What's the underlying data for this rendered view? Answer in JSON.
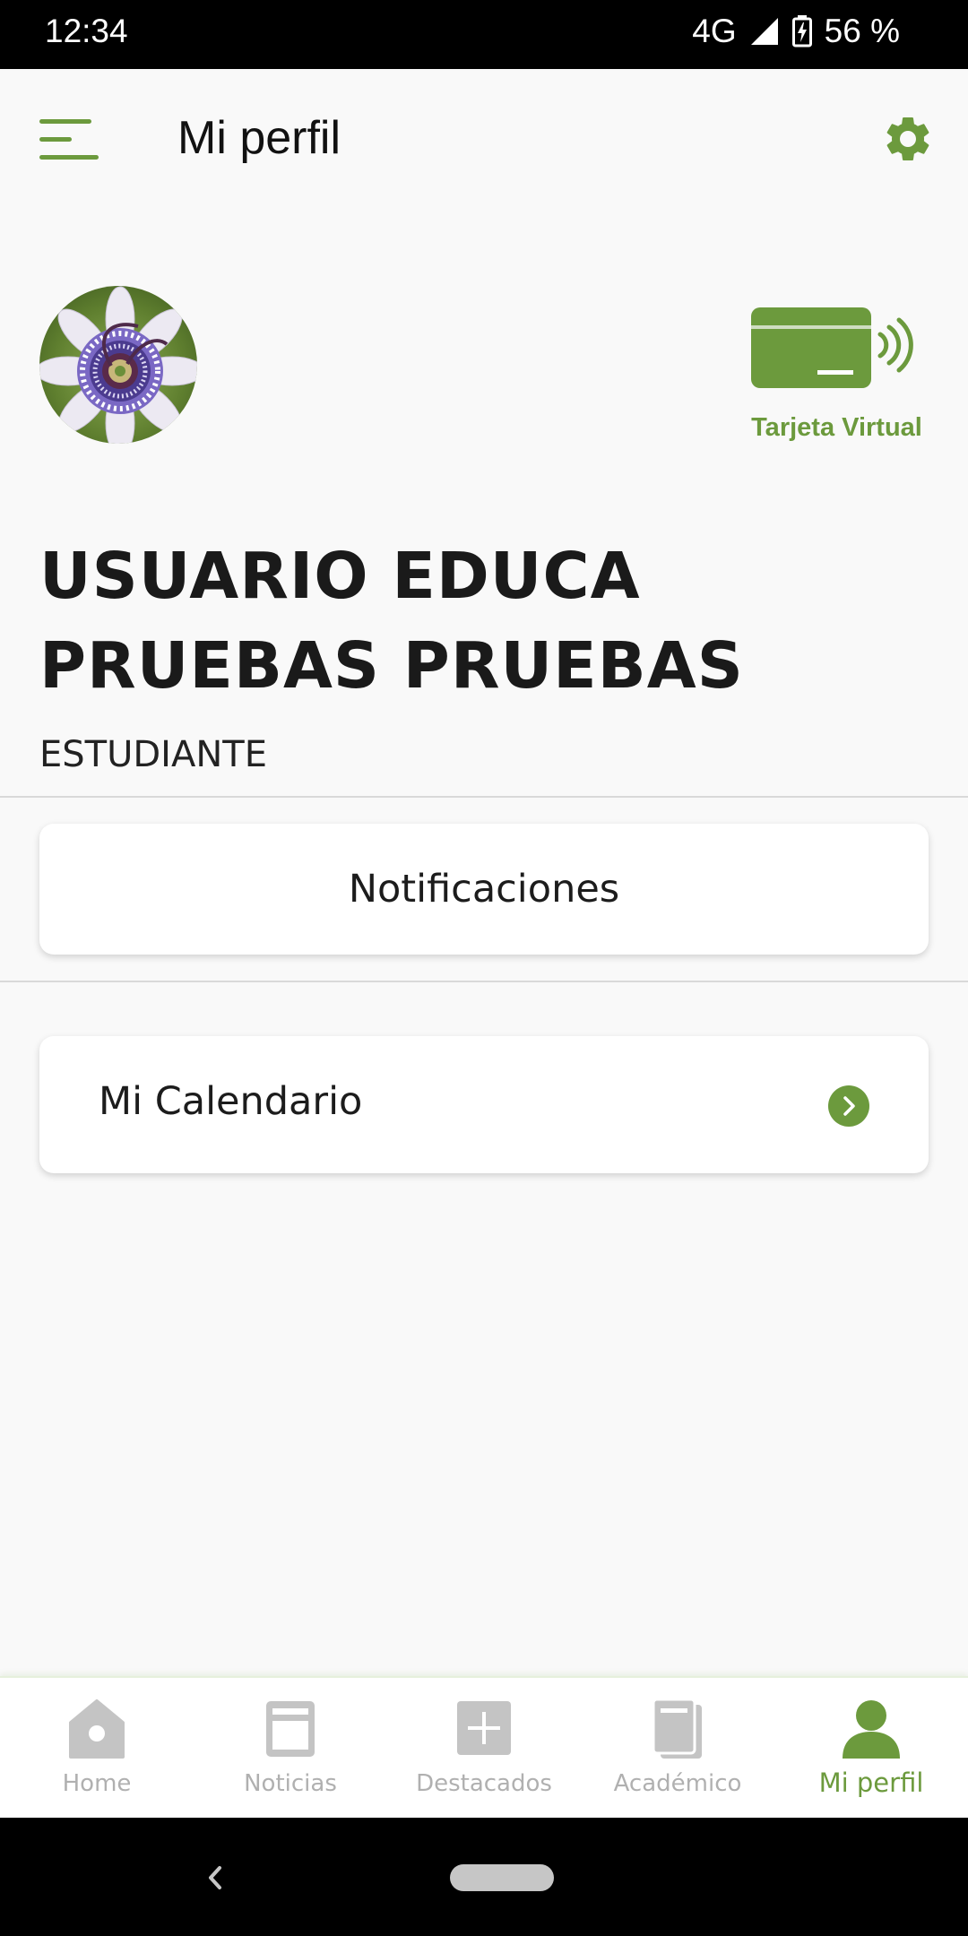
{
  "status_bar": {
    "time": "12:34",
    "network": "4G",
    "battery": "56 %"
  },
  "header": {
    "title": "Mi perfil",
    "menu_icon": "hamburger-menu-icon",
    "settings_icon": "gear-icon"
  },
  "profile": {
    "avatar": "passion-flower-photo",
    "virtual_card_label": "Tarjeta Virtual",
    "name": "USUARIO EDUCA PRUEBAS PRUEBAS",
    "role": "ESTUDIANTE"
  },
  "sections": {
    "notifications_label": "Notificaciones",
    "calendar_label": "Mi Calendario"
  },
  "bottom_nav": {
    "items": [
      {
        "label": "Home",
        "icon": "home-icon"
      },
      {
        "label": "Noticias",
        "icon": "news-icon"
      },
      {
        "label": "Destacados",
        "icon": "plus-box-icon"
      },
      {
        "label": "Académico",
        "icon": "book-icon"
      },
      {
        "label": "Mi perfil",
        "icon": "person-icon"
      }
    ],
    "active_index": 4
  },
  "colors": {
    "accent": "#6c9a3d",
    "inactive": "#b0b0b0",
    "background": "#f9f9f9"
  }
}
